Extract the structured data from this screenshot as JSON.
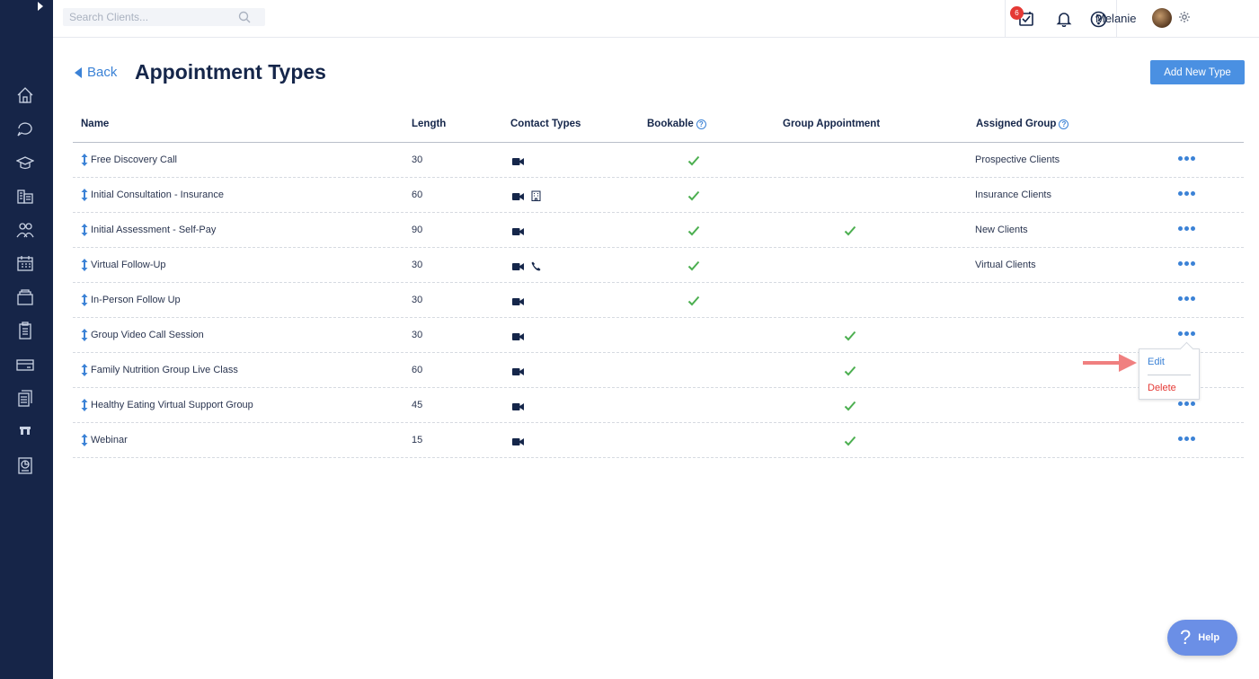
{
  "search": {
    "placeholder": "Search Clients..."
  },
  "topbar": {
    "notification_count": "6",
    "username": "Melanie"
  },
  "header": {
    "back_label": "Back",
    "title": "Appointment Types",
    "add_button_label": "Add New Type"
  },
  "table": {
    "columns": [
      "Name",
      "Length",
      "Contact Types",
      "Bookable",
      "Group Appointment",
      "Assigned Group"
    ],
    "rows": [
      {
        "name": "Free Discovery Call",
        "length": "30",
        "contact_types": [
          "video"
        ],
        "bookable": true,
        "group": false,
        "assigned_group": "Prospective Clients"
      },
      {
        "name": "Initial Consultation - Insurance",
        "length": "60",
        "contact_types": [
          "video",
          "in-person"
        ],
        "bookable": true,
        "group": false,
        "assigned_group": "Insurance Clients"
      },
      {
        "name": "Initial Assessment - Self-Pay",
        "length": "90",
        "contact_types": [
          "video"
        ],
        "bookable": true,
        "group": true,
        "assigned_group": "New Clients"
      },
      {
        "name": "Virtual Follow-Up",
        "length": "30",
        "contact_types": [
          "video",
          "phone"
        ],
        "bookable": true,
        "group": false,
        "assigned_group": "Virtual Clients"
      },
      {
        "name": "In-Person Follow Up",
        "length": "30",
        "contact_types": [
          "video"
        ],
        "bookable": true,
        "group": false,
        "assigned_group": ""
      },
      {
        "name": "Group Video Call Session",
        "length": "30",
        "contact_types": [
          "video"
        ],
        "bookable": false,
        "group": true,
        "assigned_group": ""
      },
      {
        "name": "Family Nutrition Group Live Class",
        "length": "60",
        "contact_types": [
          "video"
        ],
        "bookable": false,
        "group": true,
        "assigned_group": ""
      },
      {
        "name": "Healthy Eating Virtual Support Group",
        "length": "45",
        "contact_types": [
          "video"
        ],
        "bookable": false,
        "group": true,
        "assigned_group": ""
      },
      {
        "name": "Webinar",
        "length": "15",
        "contact_types": [
          "video"
        ],
        "bookable": false,
        "group": true,
        "assigned_group": ""
      }
    ]
  },
  "menu": {
    "edit_label": "Edit",
    "delete_label": "Delete"
  },
  "help": {
    "label": "Help"
  },
  "colors": {
    "sidebar": "#162548",
    "accent": "#3b82d6",
    "check": "#4caf50",
    "danger": "#e53935",
    "annotation": "#f08080"
  }
}
